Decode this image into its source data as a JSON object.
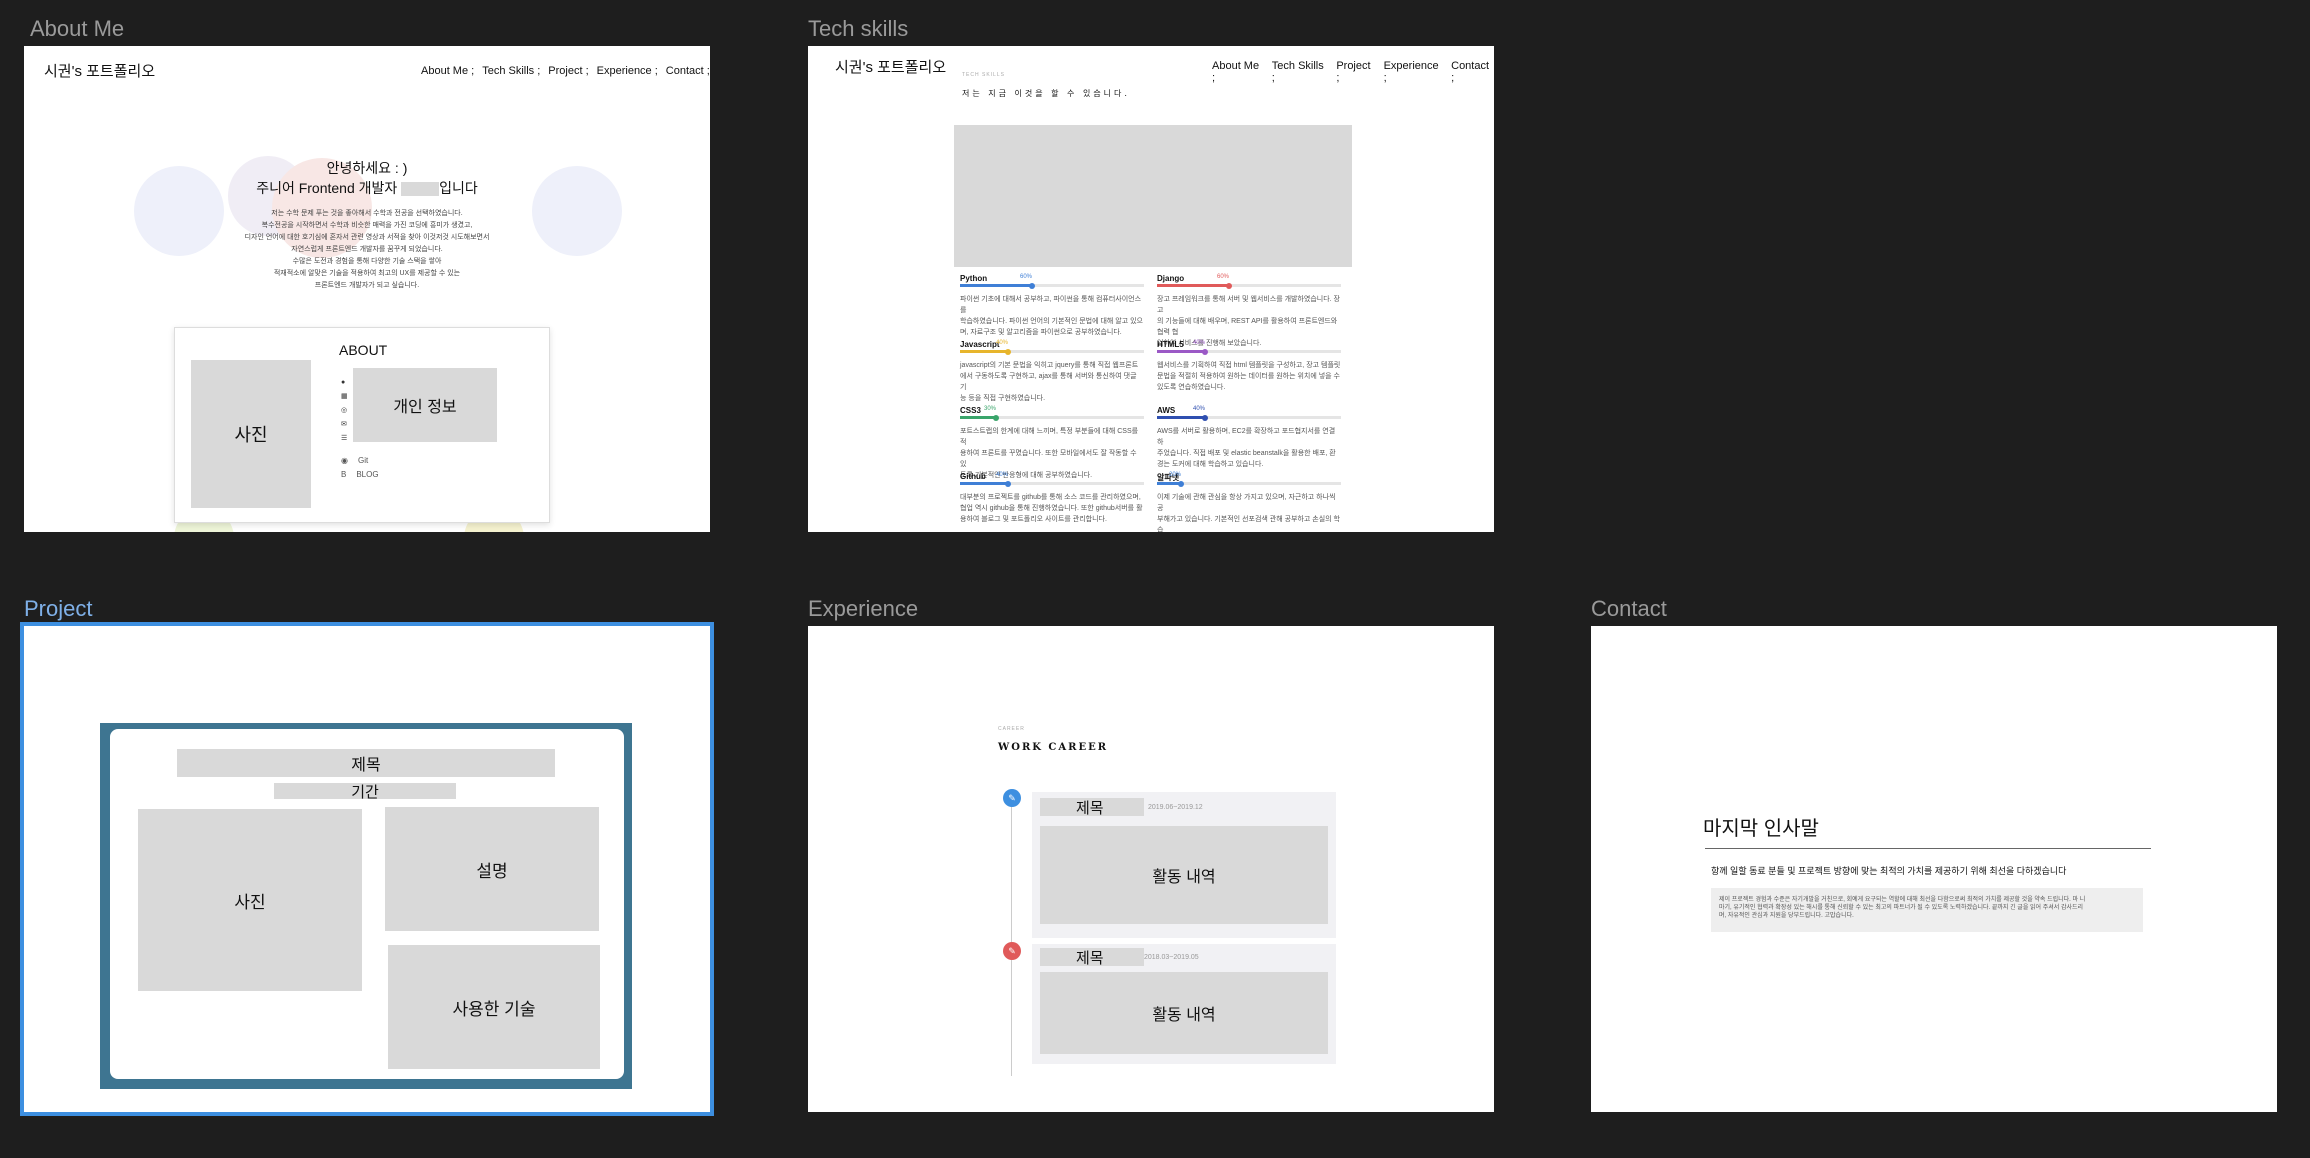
{
  "frames": {
    "about": {
      "label": "About Me"
    },
    "tech": {
      "label": "Tech skills"
    },
    "project": {
      "label": "Project"
    },
    "experience": {
      "label": "Experience"
    },
    "contact": {
      "label": "Contact"
    }
  },
  "site": {
    "logo": "시권's 포트폴리오",
    "nav": [
      "About Me ;",
      "Tech Skills ;",
      "Project ;",
      "Experience ;",
      "Contact ;"
    ]
  },
  "about": {
    "greeting": "안녕하세요 : )",
    "intro_prefix": "주니어 Frontend 개발자",
    "intro_suffix": "입니다",
    "paragraph": [
      "저는 수학 문제 푸는 것을 좋아해서 수학과 전공을 선택하였습니다.",
      "복수전공을 시작하면서 수학과 비슷한 매력을 가진 코딩에 흥미가 생겼고,",
      "디자인 언어에 대한 호기심에 혼자서 관련 영상과 서적을 찾아 이것저것 시도해보면서",
      "자연스럽게 프론트엔드 개발자를 꿈꾸게 되었습니다.",
      "수많은 도전과 경험을 통해 다양한 기술 스택을 쌓아",
      "적재적소에 알맞은 기술을 적용하여 최고의 UX를 제공할 수 있는",
      "프론트엔드 개발자가 되고 싶습니다."
    ],
    "card_title": "ABOUT",
    "photo": "사진",
    "info": "개인 정보",
    "git": "Git",
    "blog": "BLOG"
  },
  "tech": {
    "eyebrow": "TECH SKILLS",
    "heading": "저는 지금 이것을 할 수 있습니다.",
    "skills_left": [
      {
        "name": "Python",
        "pct": "60%",
        "value": 0.6,
        "color": "#3f7fd6",
        "desc": [
          "파이썬 기초에 대해서 공부하고, 파이썬을 통해 컴퓨터사이언스를",
          "학습하였습니다. 파이썬 언어의 기본적인 문법에 대해 알고 있으",
          "며, 자료구조 및 알고리즘을 파이썬으로 공부하였습니다."
        ]
      },
      {
        "name": "Javascript",
        "pct": "40%",
        "value": 0.4,
        "color": "#e7b52c",
        "desc": [
          "javascript의 기본 문법을 익히고 jquery를 통해 직접 웹프론트",
          "에서 구동하도록 구현하고, ajax를 통해 서버와 통신하여 댓글 기",
          "능 등을 직접 구현하였습니다."
        ]
      },
      {
        "name": "CSS3",
        "pct": "30%",
        "value": 0.3,
        "color": "#3aa56b",
        "desc": [
          "포트스트랩의 한계에 대해 느끼며, 특정 부분들에 대해 CSS를 적",
          "용하여 프론트를 꾸몄습니다. 또한 모바일에서도 잘 작동할 수 있",
          "도록 기본적인 반응형에 대해 공부하였습니다."
        ]
      },
      {
        "name": "Github",
        "pct": "40%",
        "value": 0.4,
        "color": "#3f7fd6",
        "desc": [
          "대부분의 프로젝트를 github를 통해 소스 코드를 관리하였으며,",
          "협업 역시 github을 통해 진행하였습니다. 또한 github서버를 활",
          "용하여 블로그 및 포트폴리오 사이트를 관리합니다."
        ]
      }
    ],
    "skills_right": [
      {
        "name": "Django",
        "pct": "60%",
        "value": 0.6,
        "color": "#e05a5a",
        "desc": [
          "장고 프레임워크를 통해 서버 및 웹서비스를 개발하였습니다. 장고",
          "의 기능들에 대해 배우며, REST API를 활용하여 프론트엔드와 협력 협",
          "업하여 서비스를 진행해 보았습니다."
        ]
      },
      {
        "name": "HTML5",
        "pct": "40%",
        "value": 0.4,
        "color": "#9b59c6",
        "desc": [
          "웹서비스를 기획하여 직접 html 템플릿을 구성하고, 장고 템플릿",
          "문법을 적절히 적용하여 원하는 데이터를 원하는 위치에 넣을 수",
          "있도록 연습하였습니다."
        ]
      },
      {
        "name": "AWS",
        "pct": "40%",
        "value": 0.4,
        "color": "#2f4fb0",
        "desc": [
          "AWS를 서버로 활용하며, EC2를 확장하고 포드협지서를 연결하",
          "주었습니다. 직접 배포 및 elastic beanstalk을 활용한 배포, 환",
          "경는 도커에 대해 학습하고 있습니다."
        ]
      },
      {
        "name": "알파넷",
        "pct": "20%",
        "value": 0.2,
        "color": "#3f7fd6",
        "desc": [
          "이제 기술에 관해 관심을 항상 가지고 있으며, 자근하고 하나씩 공",
          "부해가고 있습니다. 기본적인 선포검색 관해 공부하고 손실의 학습",
          "을 해 체계로 공부하였습니다."
        ]
      }
    ]
  },
  "project": {
    "title": "제목",
    "period": "기간",
    "photo": "사진",
    "description": "설명",
    "tech_used": "사용한 기술"
  },
  "experience": {
    "eyebrow": "CAREER",
    "heading": "WORK CAREER",
    "items": [
      {
        "title": "제목",
        "date": "2019.06~2019.12",
        "activity": "활동 내역",
        "icon_color": "#3d8fe0"
      },
      {
        "title": "제목",
        "date": "2018.03~2019.05",
        "activity": "활동 내역",
        "icon_color": "#e05a5a"
      }
    ]
  },
  "contact": {
    "heading": "마지막 인사말",
    "subheading": "항께 일할 동료 분들 및 프로젝트 방향에 맞는 최적의 가치를 제공하기 위해 최선을 다하겠습니다",
    "body": [
      "제이 프로젝트 경험과 수준은 자기개발을 거친으로, 회예게 요구되는 역할에 대해 최선을 다함으로써 최적의 가치를 제공할 것을 약속 드립니다. 마 니",
      "마기, 유기적인 협력과 확장성 있는 해시를 통해 신뢰할 수 있는 최고의 파트너가 될 수 있도록 노력하겠습니다. 끝까지 긴 글을 읽어 주셔서 감사드리",
      "며, 자유적인 관심과 지원을 당부드립니다. 고맙습니다."
    ]
  },
  "colors": {
    "canvas": "#1e1e1e",
    "selection": "#3d8fe0",
    "project_teal": "#3e7591"
  }
}
